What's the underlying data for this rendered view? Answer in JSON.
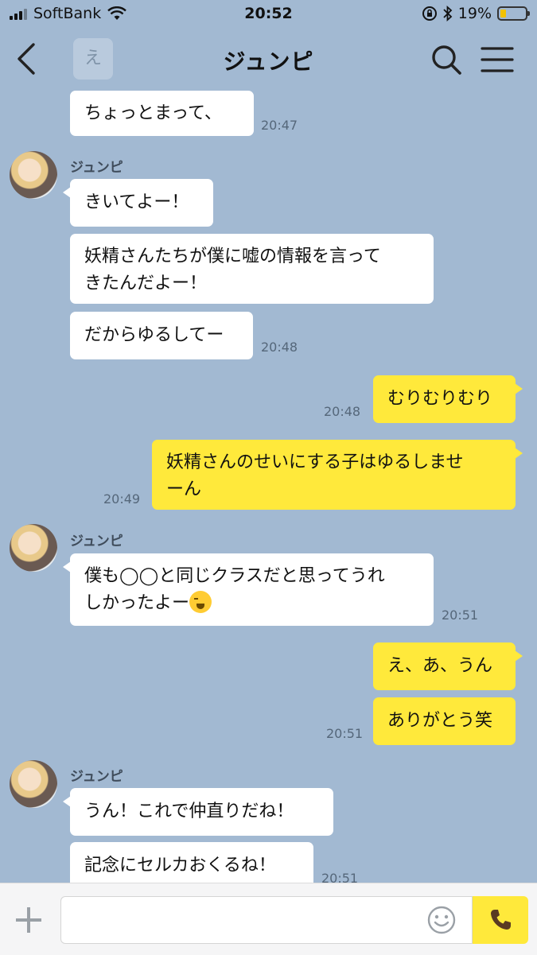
{
  "status_bar": {
    "carrier": "SoftBank",
    "time": "20:52",
    "battery": "19%",
    "icons": [
      "signal-icon",
      "wifi-icon",
      "orientation-lock-icon",
      "bluetooth-icon",
      "battery-icon"
    ]
  },
  "header": {
    "title": "ジュンピ",
    "ghost_char": "え",
    "icons": [
      "back-chevron-icon",
      "search-icon",
      "menu-icon"
    ]
  },
  "messages": [
    {
      "side": "in",
      "text": "ちょっとまって、",
      "time": "20:47"
    },
    {
      "side": "in",
      "sender": "ジュンピ",
      "text": "きいてよー！"
    },
    {
      "side": "in",
      "text_lines": [
        "妖精さんたちが僕に嘘の情報を言って",
        "きたんだよー！"
      ]
    },
    {
      "side": "in",
      "text": "だからゆるしてー",
      "time": "20:48"
    },
    {
      "side": "out",
      "text": "むりむりむり",
      "time": "20:48"
    },
    {
      "side": "out",
      "text_lines": [
        "妖精さんのせいにする子はゆるしませ",
        "ーん"
      ],
      "time": "20:49"
    },
    {
      "side": "in",
      "sender": "ジュンピ",
      "text_lines": [
        "僕も◯◯と同じクラスだと思ってうれ",
        "しかったよー"
      ],
      "emoji": "loudly-crying-face-icon",
      "time": "20:51"
    },
    {
      "side": "out",
      "text": "え、あ、うん"
    },
    {
      "side": "out",
      "text": "ありがとう笑",
      "time": "20:51"
    },
    {
      "side": "in",
      "sender": "ジュンピ",
      "text": "うん！これで仲直りだね！"
    },
    {
      "side": "in",
      "text": "記念にセルカおくるね！",
      "time": "20:51"
    }
  ],
  "input_bar": {
    "placeholder": "",
    "icons": [
      "plus-icon",
      "smiley-icon",
      "phone-icon"
    ],
    "accent_color": "#ffe93b"
  },
  "colors": {
    "background": "#a2b9d2",
    "outgoing_bubble": "#ffe93b",
    "incoming_bubble": "#ffffff"
  }
}
